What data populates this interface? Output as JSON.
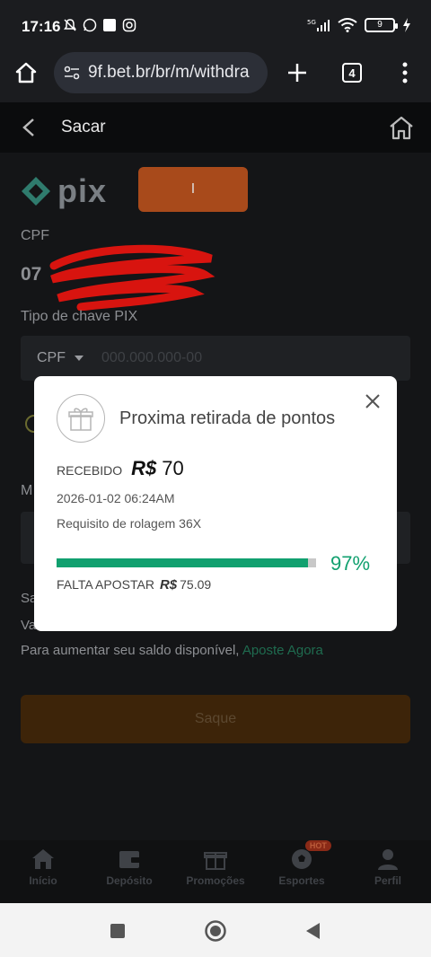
{
  "status_bar": {
    "time": "17:16",
    "battery": "9",
    "network": "5G"
  },
  "browser": {
    "url": "9f.bet.br/br/m/withdra",
    "tab_count": "4"
  },
  "header": {
    "title": "Sacar"
  },
  "page": {
    "pix_logo_text": "pix",
    "orange_button_label": "I",
    "cpf_label": "CPF",
    "cpf_value": "07",
    "pix_key_type_label": "Tipo de chave PIX",
    "pix_key_type_value": "CPF",
    "pix_key_placeholder": "000.000.000-00",
    "amount_label_initial": "M",
    "balance_label_initial": "Sa",
    "value_label_initial": "Va",
    "increase_text": "Para aumentar seu saldo disponível,",
    "bet_now_link": "Aposte Agora",
    "withdraw_button": "Saque"
  },
  "bottom_nav": {
    "items": [
      {
        "label": "Início",
        "icon": "home-icon"
      },
      {
        "label": "Depósito",
        "icon": "wallet-icon"
      },
      {
        "label": "Promoções",
        "icon": "gift-icon"
      },
      {
        "label": "Esportes",
        "icon": "soccer-ball-icon",
        "badge": "HOT"
      },
      {
        "label": "Perfil",
        "icon": "person-icon"
      }
    ]
  },
  "modal": {
    "title": "Proxima retirada de pontos",
    "received_label": "RECEBIDO",
    "currency_symbol": "R$",
    "received_amount": "70",
    "date": "2026-01-02 06:24AM",
    "rollover_text": "Requisito de rolagem 36X",
    "progress_percent_text": "97%",
    "progress_value": 0.97,
    "remaining_label": "FALTA APOSTAR",
    "remaining_amount": "75.09"
  },
  "colors": {
    "accent_green": "#11a06f",
    "brand_orange": "#a84a1b",
    "background": "#141517"
  }
}
